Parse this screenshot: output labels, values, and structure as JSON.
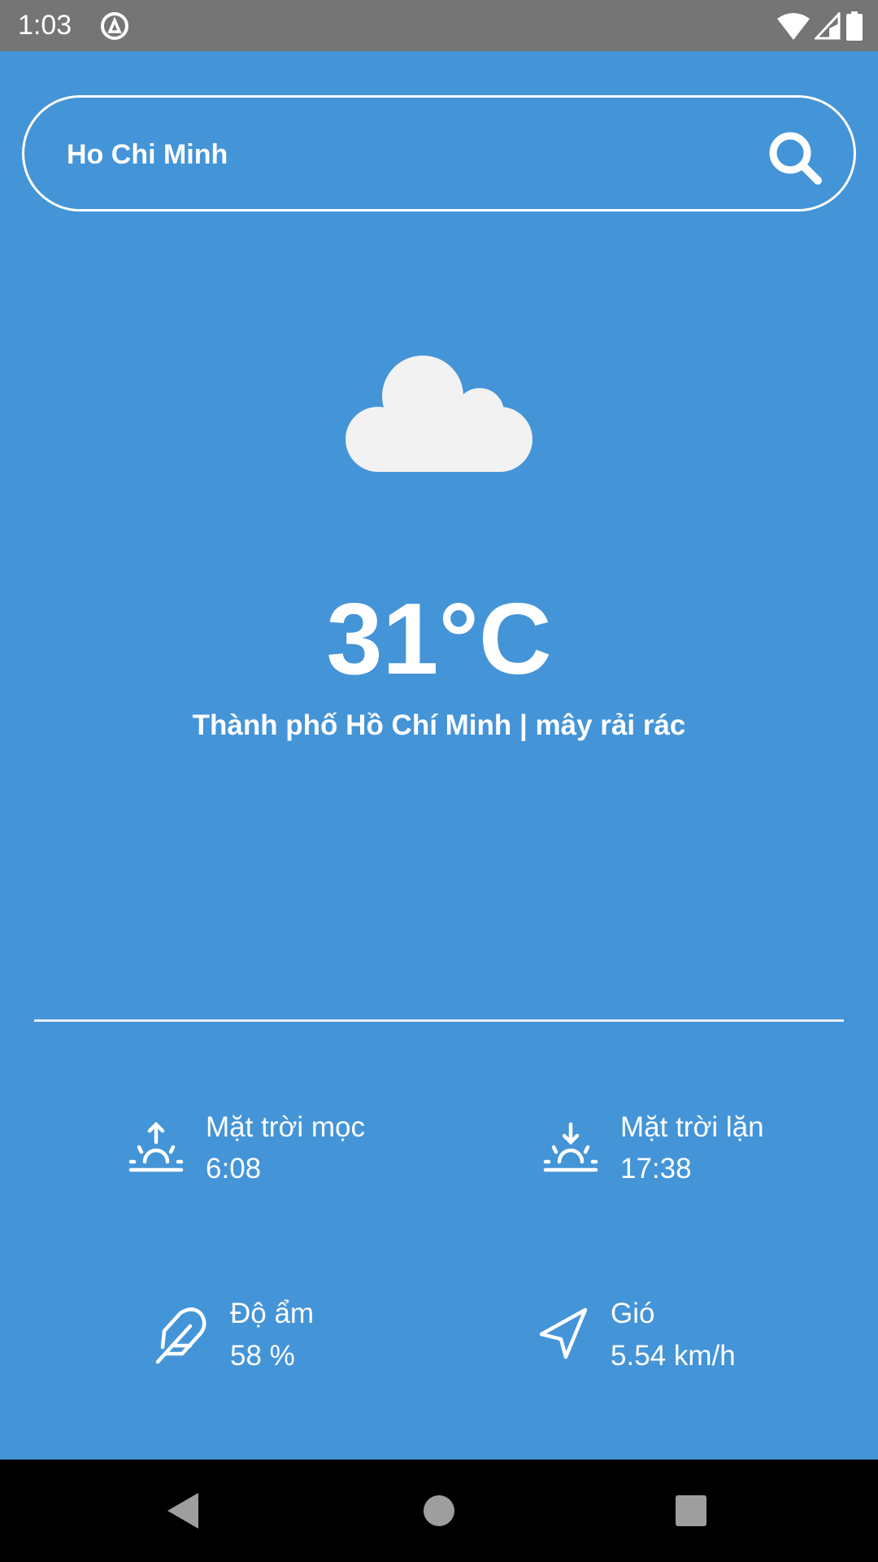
{
  "status_bar": {
    "time": "1:03",
    "icons": [
      "at-sign-icon",
      "wifi-icon",
      "signal-icon",
      "battery-icon"
    ]
  },
  "search": {
    "value": "Ho Chi Minh",
    "icon": "search-icon"
  },
  "weather": {
    "icon": "cloud-icon",
    "temperature": "31°C",
    "description": "Thành phố Hồ Chí Minh | mây rải rác"
  },
  "details": [
    {
      "icon": "sunrise-icon",
      "label": "Mặt trời mọc",
      "value": "6:08"
    },
    {
      "icon": "sunset-icon",
      "label": "Mặt trời lặn",
      "value": "17:38"
    },
    {
      "icon": "feather-icon",
      "label": "Độ ẩm",
      "value": "58 %"
    },
    {
      "icon": "navigation-icon",
      "label": "Gió",
      "value": "5.54 km/h"
    }
  ],
  "colors": {
    "background": "#4494d8",
    "status_bar": "#757575",
    "nav_bar": "#000000",
    "cloud": "#f2f2f2"
  }
}
